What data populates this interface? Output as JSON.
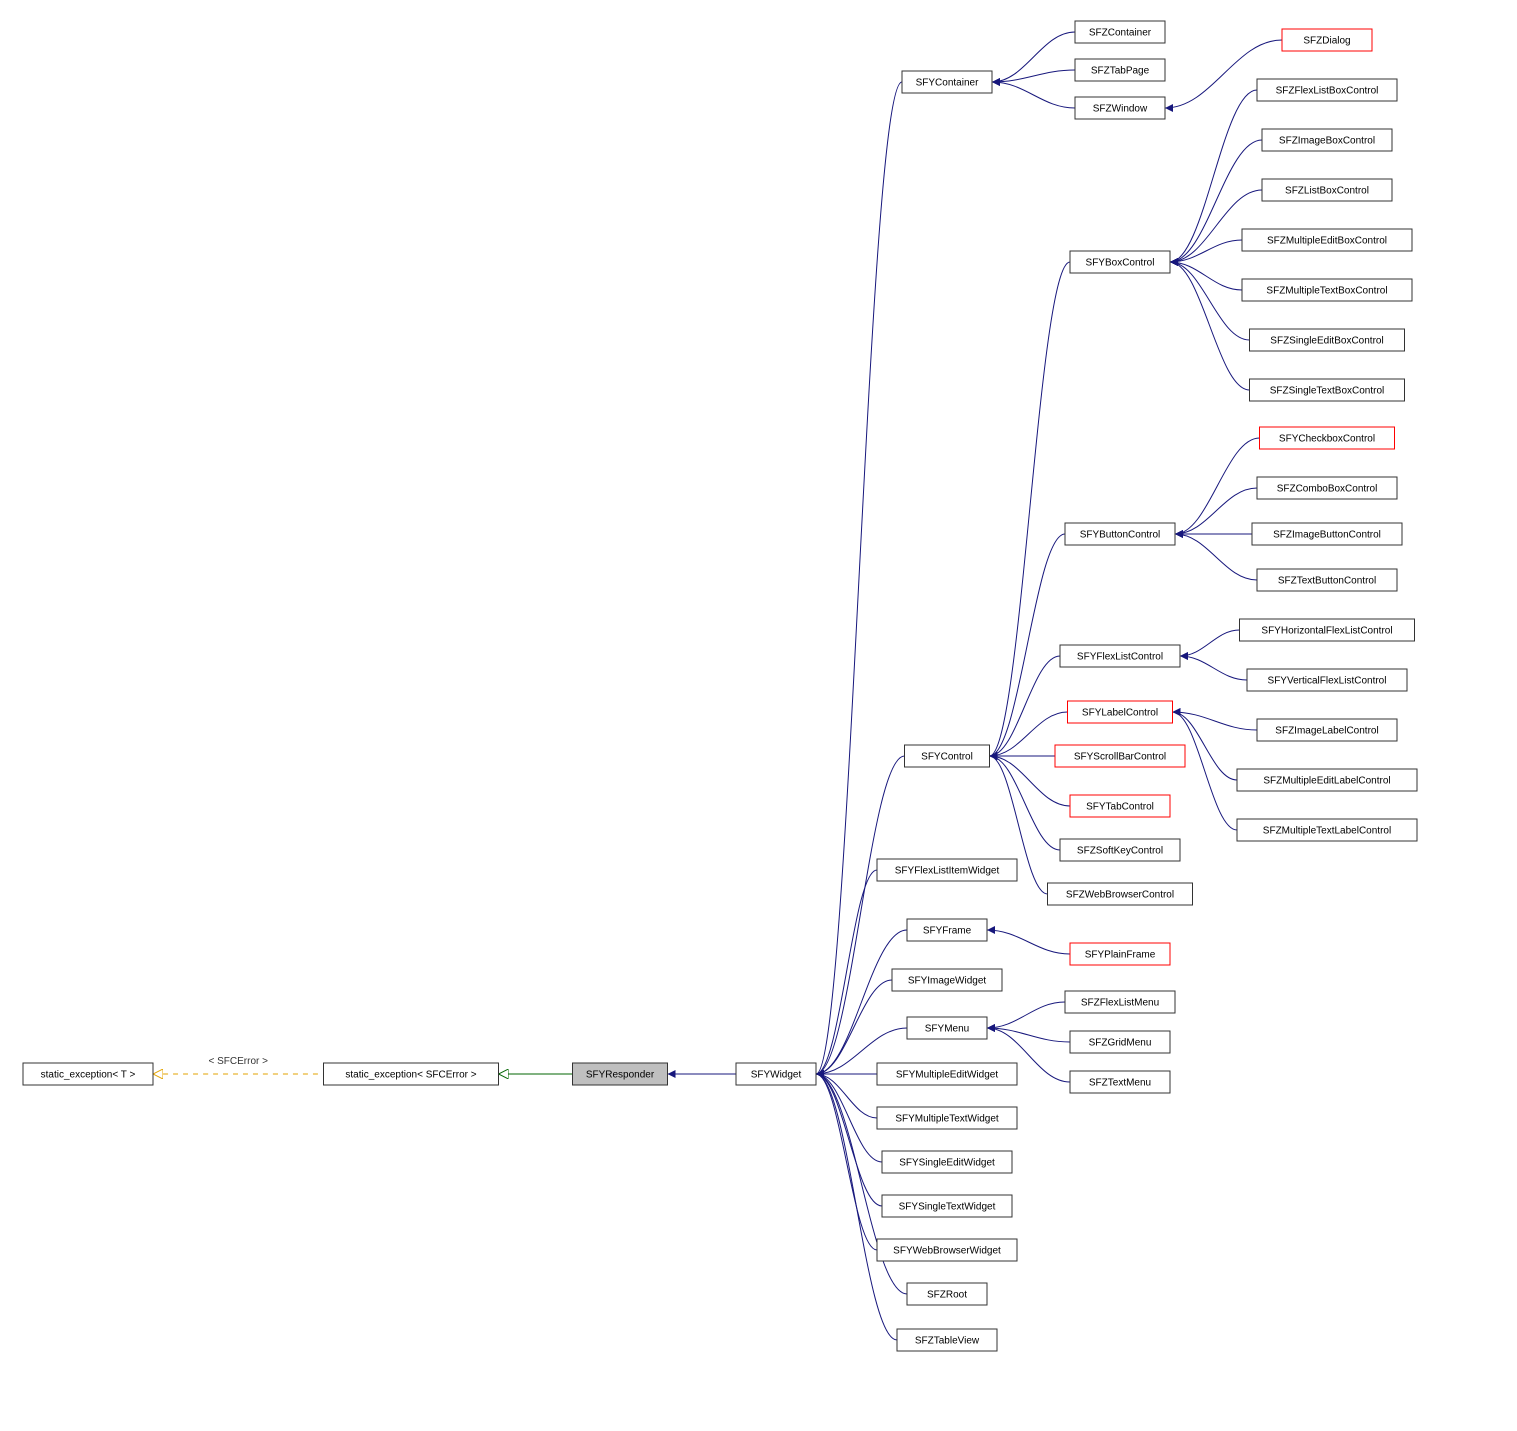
{
  "nodes": {
    "staticT": {
      "label": "static_exception< T >",
      "box": "plain"
    },
    "staticSFC": {
      "label": "static_exception< SFCError >",
      "box": "plain"
    },
    "SFYResponder": {
      "label": "SFYResponder",
      "box": "focus"
    },
    "SFYWidget": {
      "label": "SFYWidget",
      "box": "plain"
    },
    "SFYContainer": {
      "label": "SFYContainer",
      "box": "plain"
    },
    "SFZContainer": {
      "label": "SFZContainer",
      "box": "plain"
    },
    "SFZTabPage": {
      "label": "SFZTabPage",
      "box": "plain"
    },
    "SFZWindow": {
      "label": "SFZWindow",
      "box": "plain"
    },
    "SFZDialog": {
      "label": "SFZDialog",
      "box": "red"
    },
    "SFYBoxControl": {
      "label": "SFYBoxControl",
      "box": "plain"
    },
    "SFZFlexListBoxControl": {
      "label": "SFZFlexListBoxControl",
      "box": "plain"
    },
    "SFZImageBoxControl": {
      "label": "SFZImageBoxControl",
      "box": "plain"
    },
    "SFZListBoxControl": {
      "label": "SFZListBoxControl",
      "box": "plain"
    },
    "SFZMultipleEditBoxControl": {
      "label": "SFZMultipleEditBoxControl",
      "box": "plain"
    },
    "SFZMultipleTextBoxControl": {
      "label": "SFZMultipleTextBoxControl",
      "box": "plain"
    },
    "SFZSingleEditBoxControl": {
      "label": "SFZSingleEditBoxControl",
      "box": "plain"
    },
    "SFZSingleTextBoxControl": {
      "label": "SFZSingleTextBoxControl",
      "box": "plain"
    },
    "SFYButtonControl": {
      "label": "SFYButtonControl",
      "box": "plain"
    },
    "SFYCheckboxControl": {
      "label": "SFYCheckboxControl",
      "box": "red"
    },
    "SFZComboBoxControl": {
      "label": "SFZComboBoxControl",
      "box": "plain"
    },
    "SFZImageButtonControl": {
      "label": "SFZImageButtonControl",
      "box": "plain"
    },
    "SFZTextButtonControl": {
      "label": "SFZTextButtonControl",
      "box": "plain"
    },
    "SFYControl": {
      "label": "SFYControl",
      "box": "plain"
    },
    "SFYFlexListControl": {
      "label": "SFYFlexListControl",
      "box": "plain"
    },
    "SFYHorizontalFlexListControl": {
      "label": "SFYHorizontalFlexListControl",
      "box": "plain"
    },
    "SFYVerticalFlexListControl": {
      "label": "SFYVerticalFlexListControl",
      "box": "plain"
    },
    "SFYLabelControl": {
      "label": "SFYLabelControl",
      "box": "red"
    },
    "SFZImageLabelControl": {
      "label": "SFZImageLabelControl",
      "box": "plain"
    },
    "SFZMultipleEditLabelControl": {
      "label": "SFZMultipleEditLabelControl",
      "box": "plain"
    },
    "SFZMultipleTextLabelControl": {
      "label": "SFZMultipleTextLabelControl",
      "box": "plain"
    },
    "SFYScrollBarControl": {
      "label": "SFYScrollBarControl",
      "box": "red"
    },
    "SFYTabControl": {
      "label": "SFYTabControl",
      "box": "red"
    },
    "SFZSoftKeyControl": {
      "label": "SFZSoftKeyControl",
      "box": "plain"
    },
    "SFZWebBrowserControl": {
      "label": "SFZWebBrowserControl",
      "box": "plain"
    },
    "SFYFlexListItemWidget": {
      "label": "SFYFlexListItemWidget",
      "box": "plain"
    },
    "SFYFrame": {
      "label": "SFYFrame",
      "box": "plain"
    },
    "SFYPlainFrame": {
      "label": "SFYPlainFrame",
      "box": "red"
    },
    "SFYImageWidget": {
      "label": "SFYImageWidget",
      "box": "plain"
    },
    "SFYMenu": {
      "label": "SFYMenu",
      "box": "plain"
    },
    "SFZFlexListMenu": {
      "label": "SFZFlexListMenu",
      "box": "plain"
    },
    "SFZGridMenu": {
      "label": "SFZGridMenu",
      "box": "plain"
    },
    "SFZTextMenu": {
      "label": "SFZTextMenu",
      "box": "plain"
    },
    "SFYMultipleEditWidget": {
      "label": "SFYMultipleEditWidget",
      "box": "plain"
    },
    "SFYMultipleTextWidget": {
      "label": "SFYMultipleTextWidget",
      "box": "plain"
    },
    "SFYSingleEditWidget": {
      "label": "SFYSingleEditWidget",
      "box": "plain"
    },
    "SFYSingleTextWidget": {
      "label": "SFYSingleTextWidget",
      "box": "plain"
    },
    "SFYWebBrowserWidget": {
      "label": "SFYWebBrowserWidget",
      "box": "plain"
    },
    "SFZRoot": {
      "label": "SFZRoot",
      "box": "plain"
    },
    "SFZTableView": {
      "label": "SFZTableView",
      "box": "plain"
    }
  },
  "edgeLabel": "< SFCError >"
}
